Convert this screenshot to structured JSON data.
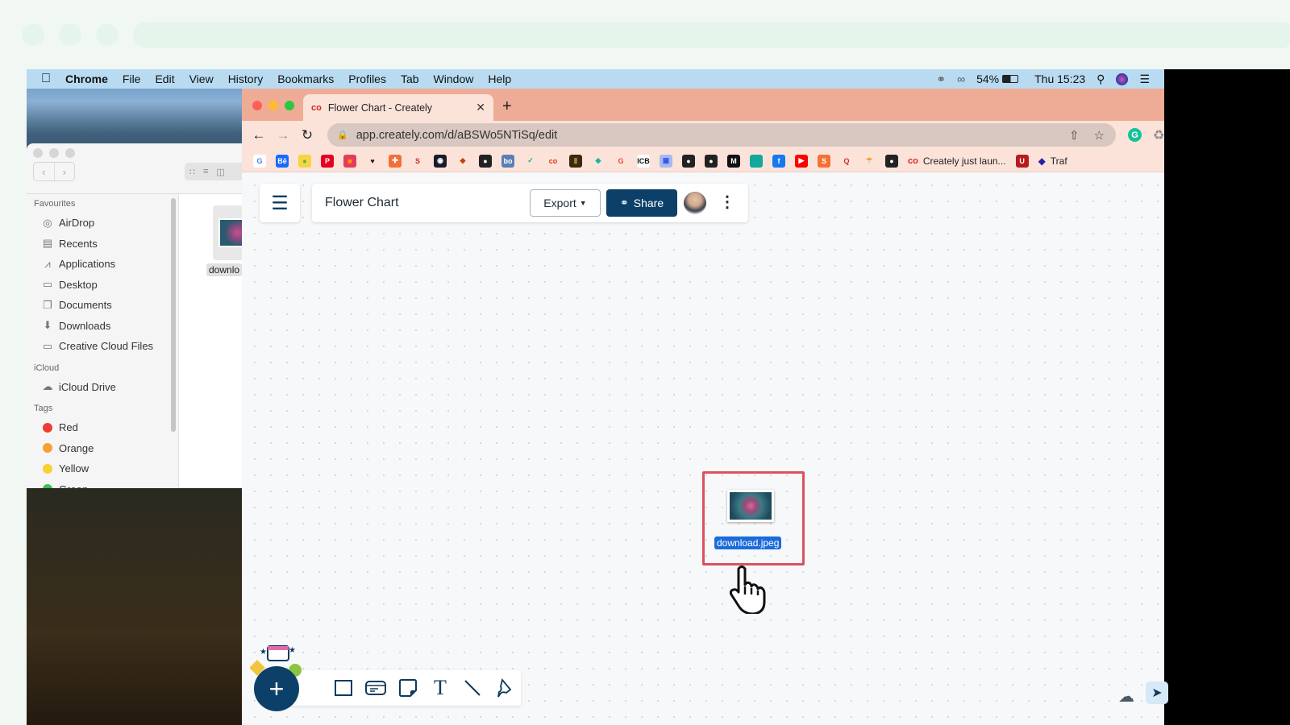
{
  "menubar": {
    "apple": "",
    "app": "Chrome",
    "items": [
      "File",
      "Edit",
      "View",
      "History",
      "Bookmarks",
      "Profiles",
      "Tab",
      "Window",
      "Help"
    ],
    "battery": "54%",
    "clock": "Thu 15:23"
  },
  "finder": {
    "favourites_label": "Favourites",
    "favourites": [
      {
        "label": "AirDrop",
        "icon": "airdrop-icon",
        "glyph": "◎"
      },
      {
        "label": "Recents",
        "icon": "recents-icon",
        "glyph": "▤"
      },
      {
        "label": "Applications",
        "icon": "applications-icon",
        "glyph": "⩘"
      },
      {
        "label": "Desktop",
        "icon": "desktop-icon",
        "glyph": "▭"
      },
      {
        "label": "Documents",
        "icon": "documents-icon",
        "glyph": "❐"
      },
      {
        "label": "Downloads",
        "icon": "downloads-icon",
        "glyph": "⬇"
      },
      {
        "label": "Creative Cloud Files",
        "icon": "folder-icon",
        "glyph": "▭"
      }
    ],
    "icloud_label": "iCloud",
    "icloud": [
      {
        "label": "iCloud Drive",
        "icon": "cloud-icon",
        "glyph": "☁"
      }
    ],
    "tags_label": "Tags",
    "tags": [
      {
        "label": "Red",
        "color": "#ef3b36"
      },
      {
        "label": "Orange",
        "color": "#f5a030"
      },
      {
        "label": "Yellow",
        "color": "#f8d030"
      },
      {
        "label": "Green",
        "color": "#3cc04a"
      }
    ],
    "file_label": "downlo"
  },
  "browser": {
    "tab_title": "Flower Chart - Creately",
    "url": "app.creately.com/d/aBSWo5NTiSq/edit",
    "bookmarks": [
      {
        "t": "G",
        "c": "#ffffff",
        "fg": "#4285f4"
      },
      {
        "t": "Bē",
        "c": "#1769ff",
        "fg": "#fff"
      },
      {
        "t": "●",
        "c": "#f5d540",
        "fg": "#6a4"
      },
      {
        "t": "P",
        "c": "#e60023",
        "fg": "#fff"
      },
      {
        "t": "■",
        "c": "#e43d5b",
        "fg": "#f90"
      },
      {
        "t": "♥",
        "c": "transparent",
        "fg": "#222"
      },
      {
        "t": "✚",
        "c": "#f26f3a",
        "fg": "#fff"
      },
      {
        "t": "S",
        "c": "transparent",
        "fg": "#d22"
      },
      {
        "t": "◉",
        "c": "#1b1b2a",
        "fg": "#fff"
      },
      {
        "t": "◆",
        "c": "transparent",
        "fg": "#c2410c"
      },
      {
        "t": "●",
        "c": "#222",
        "fg": "#fff"
      },
      {
        "t": "bo",
        "c": "#5b7fb5",
        "fg": "#fff"
      },
      {
        "t": "✓",
        "c": "transparent",
        "fg": "#1aa79c"
      },
      {
        "t": "co",
        "c": "transparent",
        "fg": "#d32"
      },
      {
        "t": "▮",
        "c": "#3a2a10",
        "fg": "#a77b3a"
      },
      {
        "t": "◆",
        "c": "transparent",
        "fg": "#1ab5a5"
      },
      {
        "t": "G",
        "c": "transparent",
        "fg": "#e44"
      },
      {
        "t": "ICB",
        "c": "#fff",
        "fg": "#111"
      },
      {
        "t": "▣",
        "c": "#a8b8f5",
        "fg": "#3355dd"
      },
      {
        "t": "●",
        "c": "#222",
        "fg": "#fff"
      },
      {
        "t": "●",
        "c": "#222",
        "fg": "#fff"
      },
      {
        "t": "M",
        "c": "#111",
        "fg": "#fff"
      },
      {
        "t": " ",
        "c": "#12a89a",
        "fg": "#fff"
      },
      {
        "t": "f",
        "c": "#1877f2",
        "fg": "#fff"
      },
      {
        "t": "▶",
        "c": "#ff0000",
        "fg": "#fff"
      },
      {
        "t": "S",
        "c": "#f57036",
        "fg": "#fff"
      },
      {
        "t": "Q",
        "c": "transparent",
        "fg": "#d22"
      },
      {
        "t": "☂",
        "c": "transparent",
        "fg": "#f5a030"
      },
      {
        "t": "●",
        "c": "#222",
        "fg": "#fff"
      }
    ],
    "bookmark_text_1": "Creately just laun...",
    "bookmark_text_2": "Traf"
  },
  "app": {
    "doc_title": "Flower Chart",
    "export_label": "Export",
    "share_label": "Share",
    "canvas_file_label": "download.jpeg"
  }
}
